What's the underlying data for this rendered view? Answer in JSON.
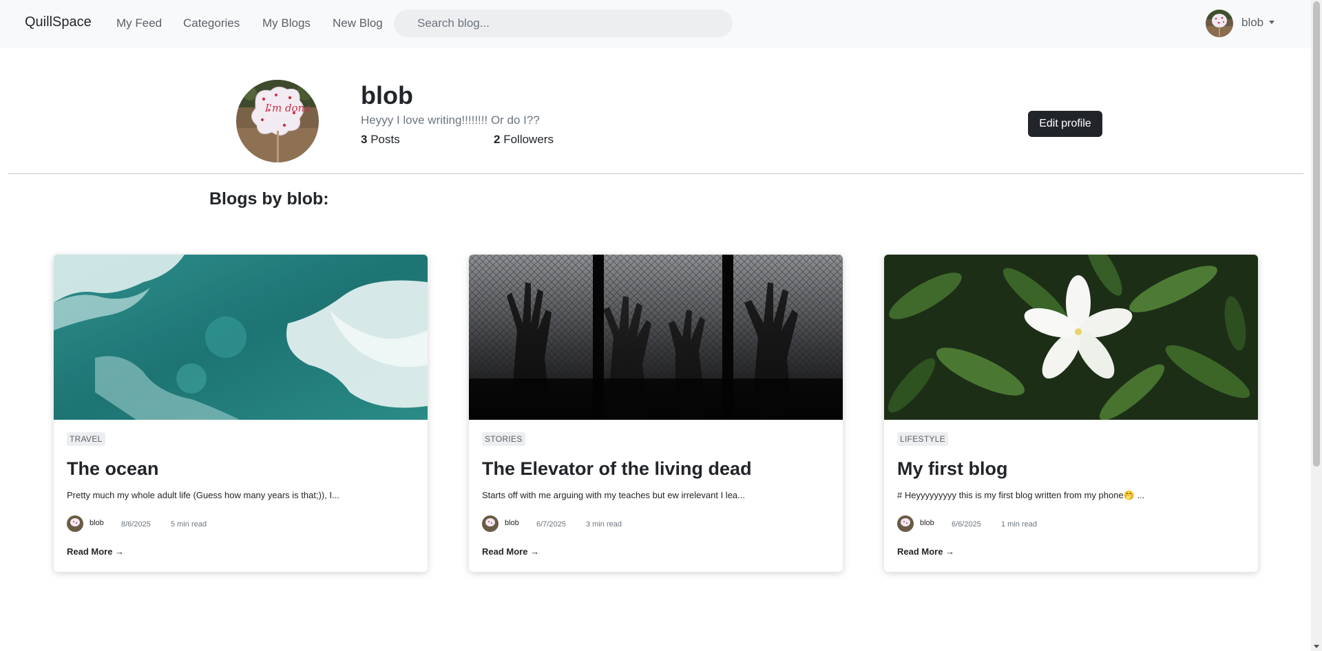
{
  "nav": {
    "brand": "QuillSpace",
    "links": [
      "My Feed",
      "Categories",
      "My Blogs",
      "New Blog"
    ],
    "search_placeholder": "Search blog...",
    "username": "blob"
  },
  "profile": {
    "name": "blob",
    "bio": "Heyyy I love writing!!!!!!!! Or do I??",
    "posts_count": "3",
    "posts_label": "Posts",
    "followers_count": "2",
    "followers_label": "Followers",
    "edit_label": "Edit profile",
    "avatar_sign_text": "I'm done"
  },
  "section_title": "Blogs by blob:",
  "cards": [
    {
      "category": "TRAVEL",
      "title": "The ocean",
      "excerpt": "Pretty much my whole adult life (Guess how many years is that;)), I...",
      "author": "blob",
      "date": "8/6/2025",
      "read_time": "5 min read",
      "read_more": "Read More →",
      "image": "ocean-waves"
    },
    {
      "category": "STORIES",
      "title": "The Elevator of the living dead",
      "excerpt": "Starts off with me arguing with my teaches but ew irrelevant I lea...",
      "author": "blob",
      "date": "6/7/2025",
      "read_time": "3 min read",
      "read_more": "Read More →",
      "image": "hands-behind-fence"
    },
    {
      "category": "LIFESTYLE",
      "title": "My first blog",
      "excerpt": "# Heyyyyyyyyy this is my first blog written from my phone🤭 ...",
      "author": "blob",
      "date": "6/6/2025",
      "read_time": "1 min read",
      "read_more": "Read More →",
      "image": "white-flower"
    }
  ]
}
